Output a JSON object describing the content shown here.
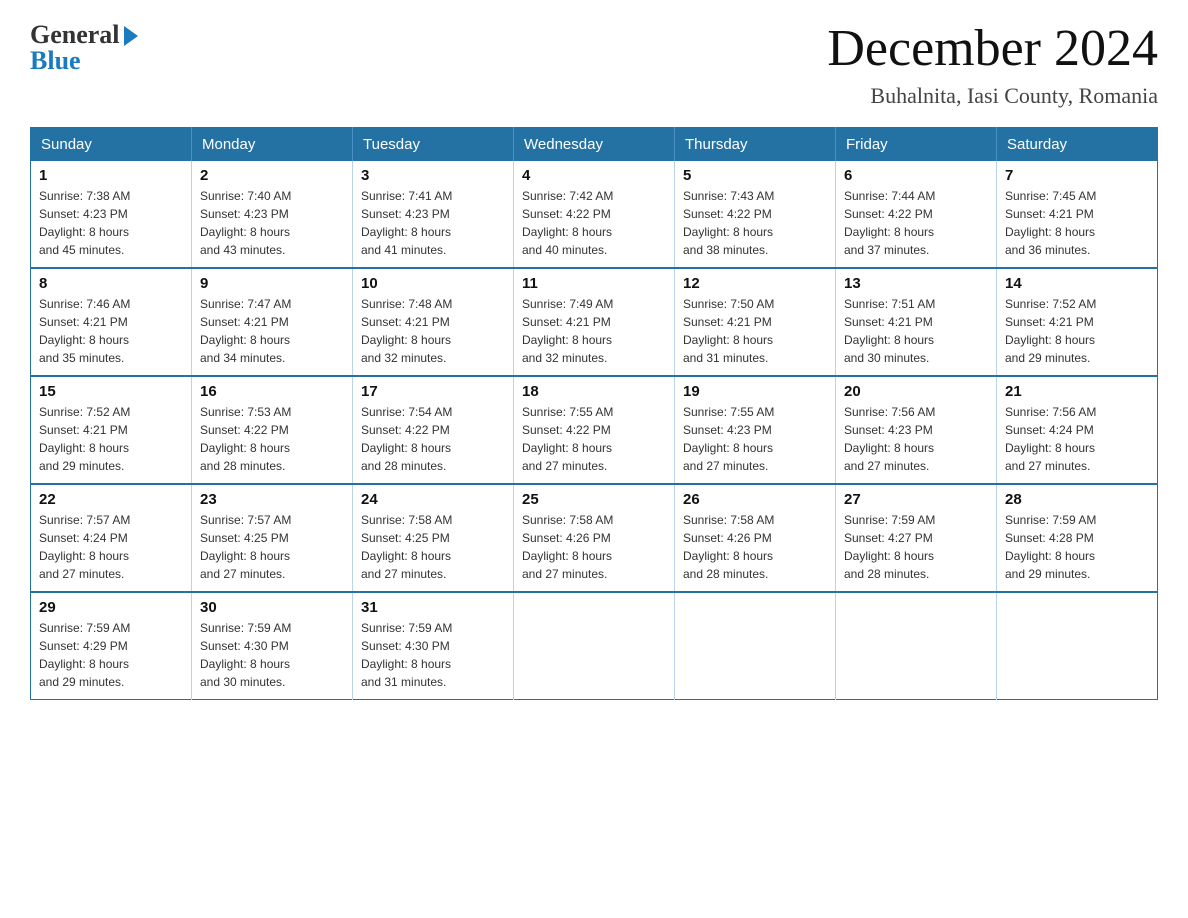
{
  "header": {
    "logo_general": "General",
    "logo_blue": "Blue",
    "main_title": "December 2024",
    "subtitle": "Buhalnita, Iasi County, Romania"
  },
  "days_of_week": [
    "Sunday",
    "Monday",
    "Tuesday",
    "Wednesday",
    "Thursday",
    "Friday",
    "Saturday"
  ],
  "weeks": [
    [
      {
        "day": "1",
        "sunrise": "7:38 AM",
        "sunset": "4:23 PM",
        "daylight": "8 hours and 45 minutes."
      },
      {
        "day": "2",
        "sunrise": "7:40 AM",
        "sunset": "4:23 PM",
        "daylight": "8 hours and 43 minutes."
      },
      {
        "day": "3",
        "sunrise": "7:41 AM",
        "sunset": "4:23 PM",
        "daylight": "8 hours and 41 minutes."
      },
      {
        "day": "4",
        "sunrise": "7:42 AM",
        "sunset": "4:22 PM",
        "daylight": "8 hours and 40 minutes."
      },
      {
        "day": "5",
        "sunrise": "7:43 AM",
        "sunset": "4:22 PM",
        "daylight": "8 hours and 38 minutes."
      },
      {
        "day": "6",
        "sunrise": "7:44 AM",
        "sunset": "4:22 PM",
        "daylight": "8 hours and 37 minutes."
      },
      {
        "day": "7",
        "sunrise": "7:45 AM",
        "sunset": "4:21 PM",
        "daylight": "8 hours and 36 minutes."
      }
    ],
    [
      {
        "day": "8",
        "sunrise": "7:46 AM",
        "sunset": "4:21 PM",
        "daylight": "8 hours and 35 minutes."
      },
      {
        "day": "9",
        "sunrise": "7:47 AM",
        "sunset": "4:21 PM",
        "daylight": "8 hours and 34 minutes."
      },
      {
        "day": "10",
        "sunrise": "7:48 AM",
        "sunset": "4:21 PM",
        "daylight": "8 hours and 32 minutes."
      },
      {
        "day": "11",
        "sunrise": "7:49 AM",
        "sunset": "4:21 PM",
        "daylight": "8 hours and 32 minutes."
      },
      {
        "day": "12",
        "sunrise": "7:50 AM",
        "sunset": "4:21 PM",
        "daylight": "8 hours and 31 minutes."
      },
      {
        "day": "13",
        "sunrise": "7:51 AM",
        "sunset": "4:21 PM",
        "daylight": "8 hours and 30 minutes."
      },
      {
        "day": "14",
        "sunrise": "7:52 AM",
        "sunset": "4:21 PM",
        "daylight": "8 hours and 29 minutes."
      }
    ],
    [
      {
        "day": "15",
        "sunrise": "7:52 AM",
        "sunset": "4:21 PM",
        "daylight": "8 hours and 29 minutes."
      },
      {
        "day": "16",
        "sunrise": "7:53 AM",
        "sunset": "4:22 PM",
        "daylight": "8 hours and 28 minutes."
      },
      {
        "day": "17",
        "sunrise": "7:54 AM",
        "sunset": "4:22 PM",
        "daylight": "8 hours and 28 minutes."
      },
      {
        "day": "18",
        "sunrise": "7:55 AM",
        "sunset": "4:22 PM",
        "daylight": "8 hours and 27 minutes."
      },
      {
        "day": "19",
        "sunrise": "7:55 AM",
        "sunset": "4:23 PM",
        "daylight": "8 hours and 27 minutes."
      },
      {
        "day": "20",
        "sunrise": "7:56 AM",
        "sunset": "4:23 PM",
        "daylight": "8 hours and 27 minutes."
      },
      {
        "day": "21",
        "sunrise": "7:56 AM",
        "sunset": "4:24 PM",
        "daylight": "8 hours and 27 minutes."
      }
    ],
    [
      {
        "day": "22",
        "sunrise": "7:57 AM",
        "sunset": "4:24 PM",
        "daylight": "8 hours and 27 minutes."
      },
      {
        "day": "23",
        "sunrise": "7:57 AM",
        "sunset": "4:25 PM",
        "daylight": "8 hours and 27 minutes."
      },
      {
        "day": "24",
        "sunrise": "7:58 AM",
        "sunset": "4:25 PM",
        "daylight": "8 hours and 27 minutes."
      },
      {
        "day": "25",
        "sunrise": "7:58 AM",
        "sunset": "4:26 PM",
        "daylight": "8 hours and 27 minutes."
      },
      {
        "day": "26",
        "sunrise": "7:58 AM",
        "sunset": "4:26 PM",
        "daylight": "8 hours and 28 minutes."
      },
      {
        "day": "27",
        "sunrise": "7:59 AM",
        "sunset": "4:27 PM",
        "daylight": "8 hours and 28 minutes."
      },
      {
        "day": "28",
        "sunrise": "7:59 AM",
        "sunset": "4:28 PM",
        "daylight": "8 hours and 29 minutes."
      }
    ],
    [
      {
        "day": "29",
        "sunrise": "7:59 AM",
        "sunset": "4:29 PM",
        "daylight": "8 hours and 29 minutes."
      },
      {
        "day": "30",
        "sunrise": "7:59 AM",
        "sunset": "4:30 PM",
        "daylight": "8 hours and 30 minutes."
      },
      {
        "day": "31",
        "sunrise": "7:59 AM",
        "sunset": "4:30 PM",
        "daylight": "8 hours and 31 minutes."
      },
      null,
      null,
      null,
      null
    ]
  ],
  "labels": {
    "sunrise": "Sunrise:",
    "sunset": "Sunset:",
    "daylight": "Daylight:"
  }
}
